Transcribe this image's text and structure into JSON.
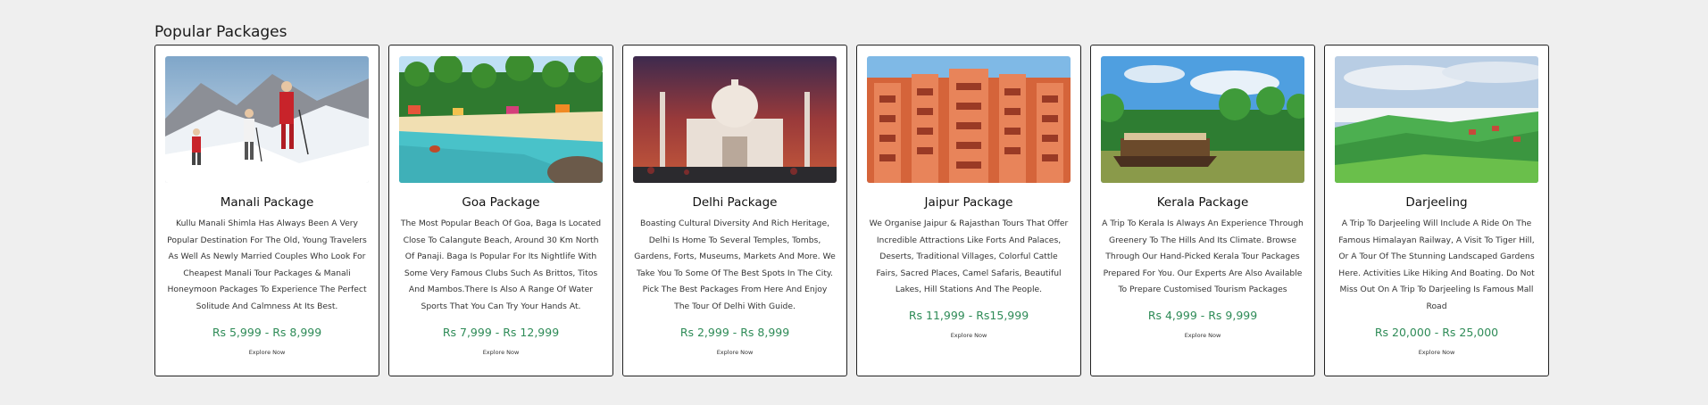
{
  "section": {
    "title": "Popular Packages"
  },
  "cards": [
    {
      "title": "Manali Package",
      "image": "snow-trekkers-photo",
      "description": "Kullu Manali Shimla Has Always Been A Very Popular Destination For The Old, Young Travelers As Well As Newly Married Couples Who Look For Cheapest Manali Tour Packages & Manali Honeymoon Packages To Experience The Perfect Solitude And Calmness At Its Best.",
      "price": "Rs 5,999 - Rs 8,999",
      "button": "Explore Now"
    },
    {
      "title": "Goa Package",
      "image": "goa-beach-photo",
      "description": "The Most Popular Beach Of Goa, Baga Is Located Close To Calangute Beach, Around 30 Km North Of Panaji. Baga Is Popular For Its Nightlife With Some Very Famous Clubs Such As Brittos, Titos And Mambos.There Is Also A Range Of Water Sports That You Can Try Your Hands At.",
      "price": "Rs 7,999 - Rs 12,999",
      "button": "Explore Now"
    },
    {
      "title": "Delhi Package",
      "image": "taj-mahal-photo",
      "description": "Boasting Cultural Diversity And Rich Heritage, Delhi Is Home To Several Temples, Tombs, Gardens, Forts, Museums, Markets And More. We Take You To Some Of The Best Spots In The City. Pick The Best Packages From Here And Enjoy The Tour Of Delhi With Guide.",
      "price": "Rs 2,999 - Rs 8,999",
      "button": "Explore Now"
    },
    {
      "title": "Jaipur Package",
      "image": "hawa-mahal-photo",
      "description": "We Organise Jaipur & Rajasthan Tours That Offer Incredible Attractions Like Forts And Palaces, Deserts, Traditional Villages, Colorful Cattle Fairs, Sacred Places, Camel Safaris, Beautiful Lakes, Hill Stations And The People.",
      "price": "Rs 11,999 - Rs15,999",
      "button": "Explore Now"
    },
    {
      "title": "Kerala Package",
      "image": "kerala-houseboat-photo",
      "description": "A Trip To Kerala Is Always An Experience Through Greenery To The Hills And Its Climate. Browse Through Our Hand-Picked Kerala Tour Packages Prepared For You. Our Experts Are Also Available To Prepare Customised Tourism Packages",
      "price": "Rs 4,999 - Rs 9,999",
      "button": "Explore Now"
    },
    {
      "title": "Darjeeling",
      "image": "darjeeling-hills-photo",
      "description": "A Trip To Darjeeling Will Include A Ride On The Famous Himalayan Railway, A Visit To Tiger Hill, Or A Tour Of The Stunning Landscaped Gardens Here. Activities Like Hiking And Boating. Do Not Miss Out On A Trip To Darjeeling Is Famous Mall Road",
      "price": "Rs 20,000 - Rs 25,000",
      "button": "Explore Now"
    }
  ],
  "colors": {
    "background": "#efefef",
    "price": "#2e8b57",
    "card_border": "#222222"
  }
}
